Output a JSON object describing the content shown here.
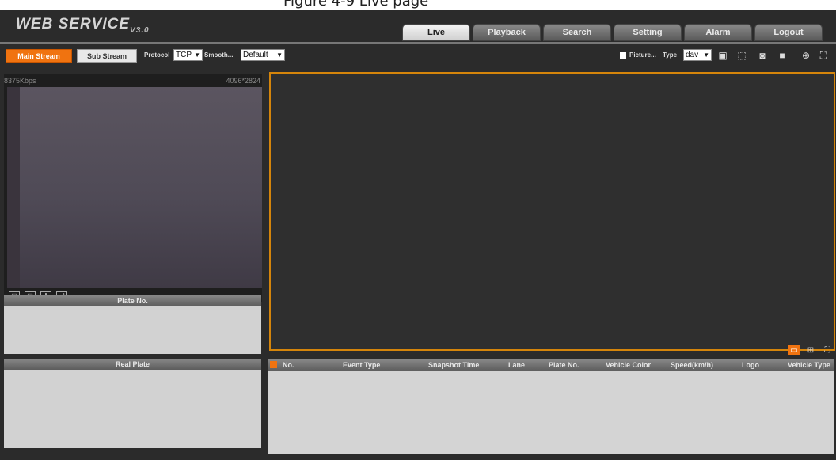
{
  "caption": "Figure 4-9 Live page",
  "app": {
    "logo": "WEB SERVICE",
    "version": "V3.0"
  },
  "tabs": [
    {
      "label": "Live",
      "active": true
    },
    {
      "label": "Playback",
      "active": false
    },
    {
      "label": "Search",
      "active": false
    },
    {
      "label": "Setting",
      "active": false
    },
    {
      "label": "Alarm",
      "active": false
    },
    {
      "label": "Logout",
      "active": false
    }
  ],
  "toolbar": {
    "main_stream": "Main Stream",
    "sub_stream": "Sub Stream",
    "protocol_label": "Protocol",
    "protocol_value": "TCP",
    "smooth_label": "Smooth...",
    "smooth_value": "Default",
    "picture_label": "Picture...",
    "type_label": "Type",
    "type_value": "dav"
  },
  "left_video": {
    "bitrate": "8375Kbps",
    "resolution": "4096*2824"
  },
  "plate_panel": {
    "title": "Plate No."
  },
  "real_plate_panel": {
    "title": "Real Plate"
  },
  "table": {
    "columns": [
      "No.",
      "Event Type",
      "Snapshot Time",
      "Lane",
      "Plate No.",
      "Vehicle Color",
      "Speed(km/h)",
      "Logo",
      "Vehicle Type"
    ]
  },
  "colors": {
    "accent": "#f07310",
    "video_border": "#d5850b",
    "background": "#2b2b2b"
  }
}
